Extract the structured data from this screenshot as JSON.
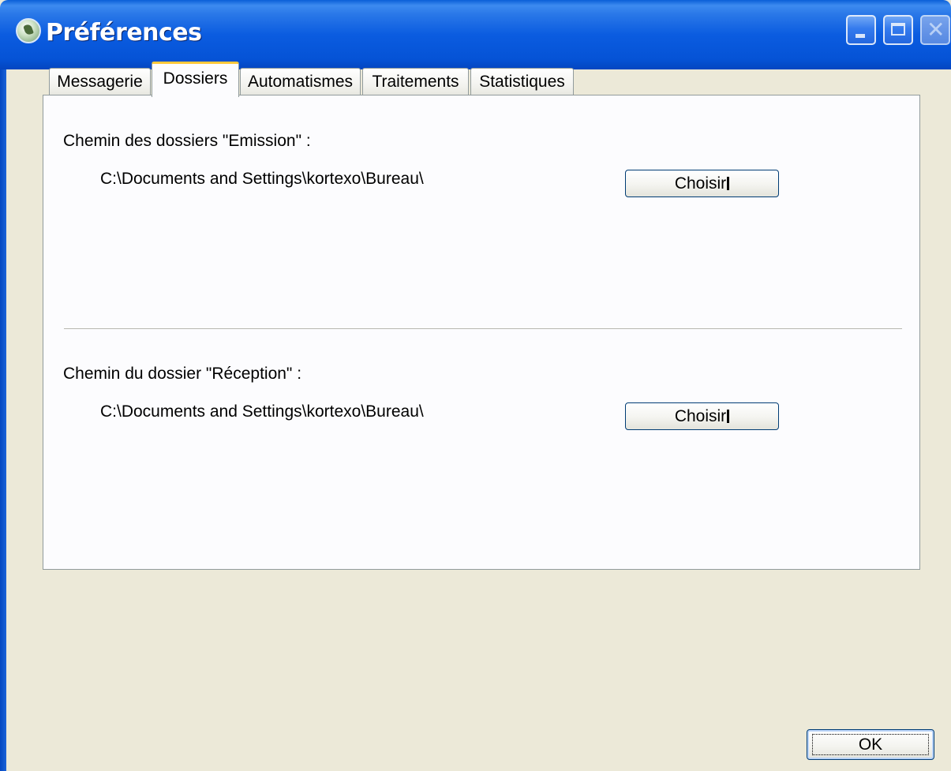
{
  "window": {
    "title": "Préférences",
    "icons": {
      "app": "app-icon",
      "minimize": "minimize-icon",
      "maximize": "maximize-icon",
      "close": "close-icon"
    },
    "close_glyph": "✕"
  },
  "tabs": [
    {
      "label": "Messagerie",
      "active": false
    },
    {
      "label": "Dossiers",
      "active": true
    },
    {
      "label": "Automatismes",
      "active": false
    },
    {
      "label": "Traitements",
      "active": false
    },
    {
      "label": "Statistiques",
      "active": false
    }
  ],
  "dossiers": {
    "emission": {
      "label": "Chemin des dossiers \"Emission\" :",
      "path": "C:\\Documents and Settings\\kortexo\\Bureau\\",
      "button": "Choisir"
    },
    "reception": {
      "label": "Chemin du dossier \"Réception\" :",
      "path": "C:\\Documents and Settings\\kortexo\\Bureau\\",
      "button": "Choisir"
    }
  },
  "footer": {
    "ok_label": "OK"
  },
  "colors": {
    "title_bar": "#0553d6",
    "active_tab_accent": "#ffc83c",
    "face": "#ece9d8"
  }
}
